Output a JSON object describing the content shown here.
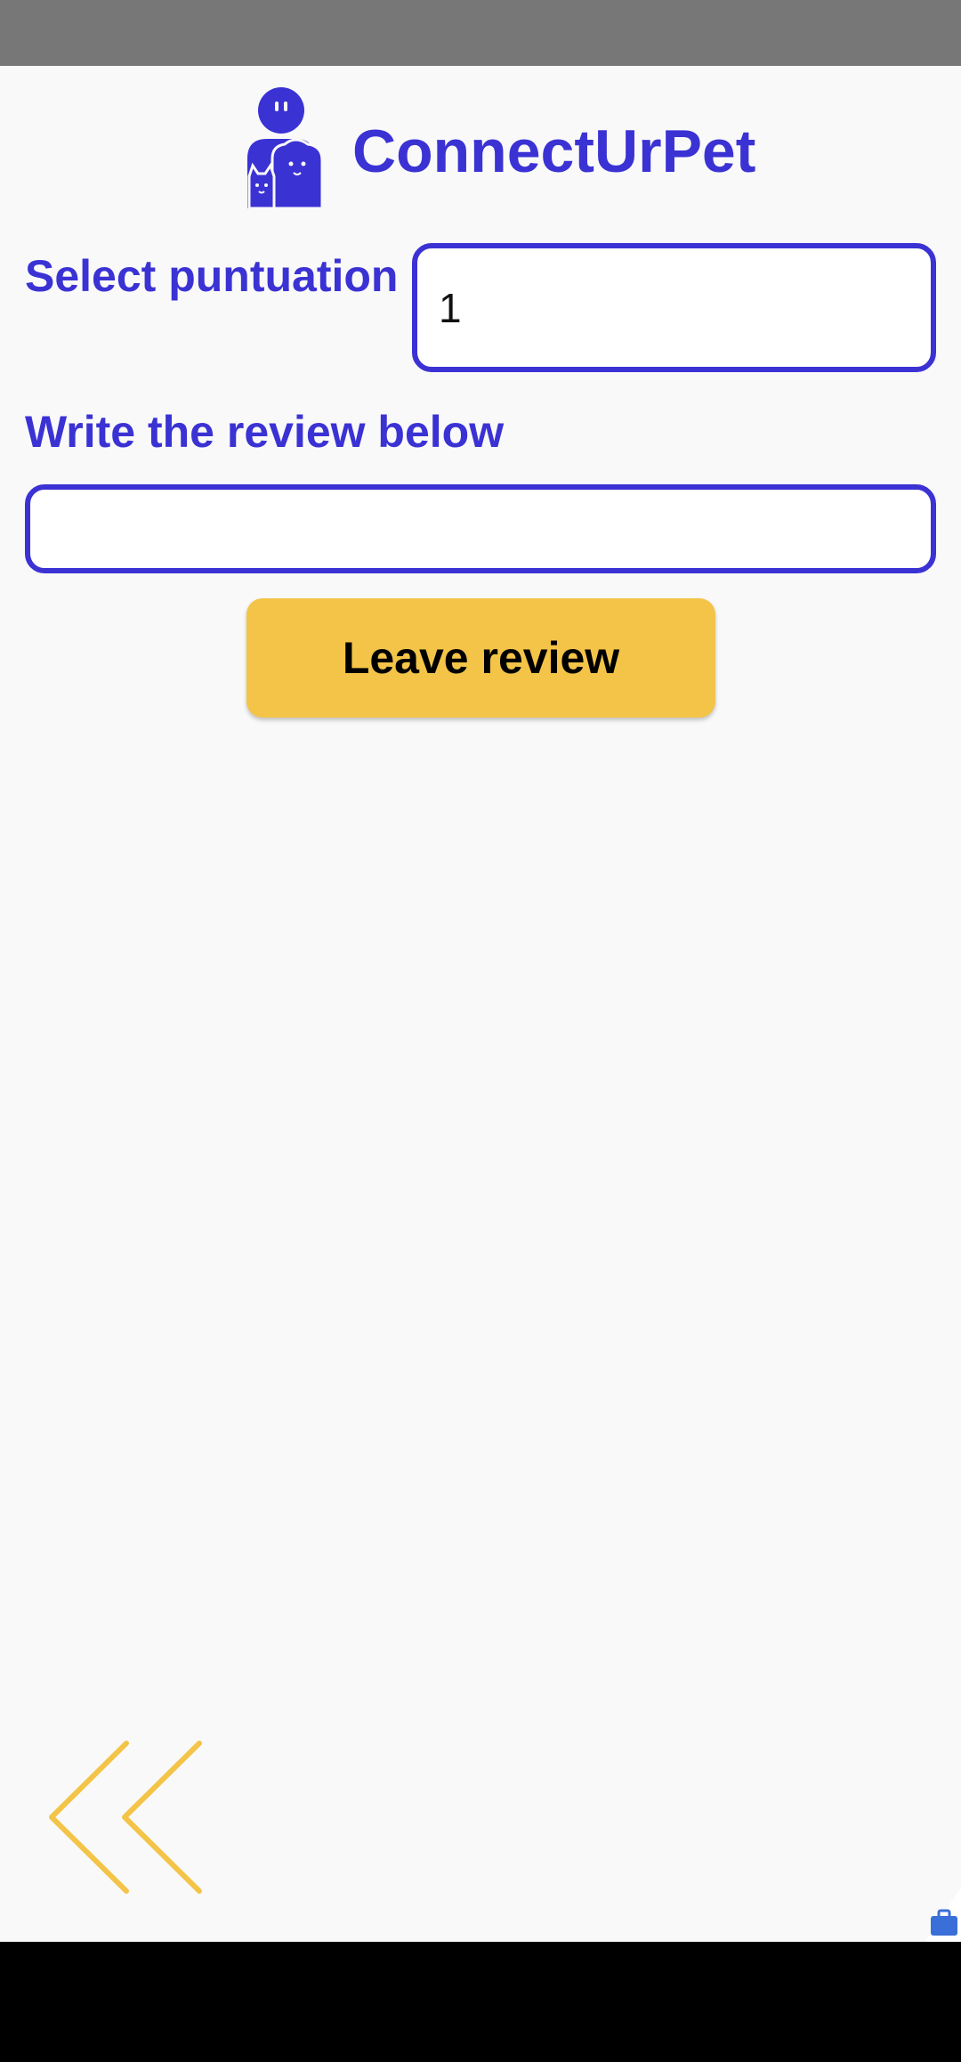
{
  "app": {
    "title": "ConnectUrPet"
  },
  "form": {
    "score_label": "Select puntuation",
    "score_value": "1",
    "review_label": "Write the review below",
    "review_value": "",
    "submit_label": "Leave review"
  },
  "icons": {
    "logo": "person-with-pets-icon",
    "back": "double-chevron-left-icon",
    "badge": "briefcase-icon"
  },
  "colors": {
    "brand": "#3b32d4",
    "accent": "#f3c448",
    "background": "#f9f9f9"
  }
}
